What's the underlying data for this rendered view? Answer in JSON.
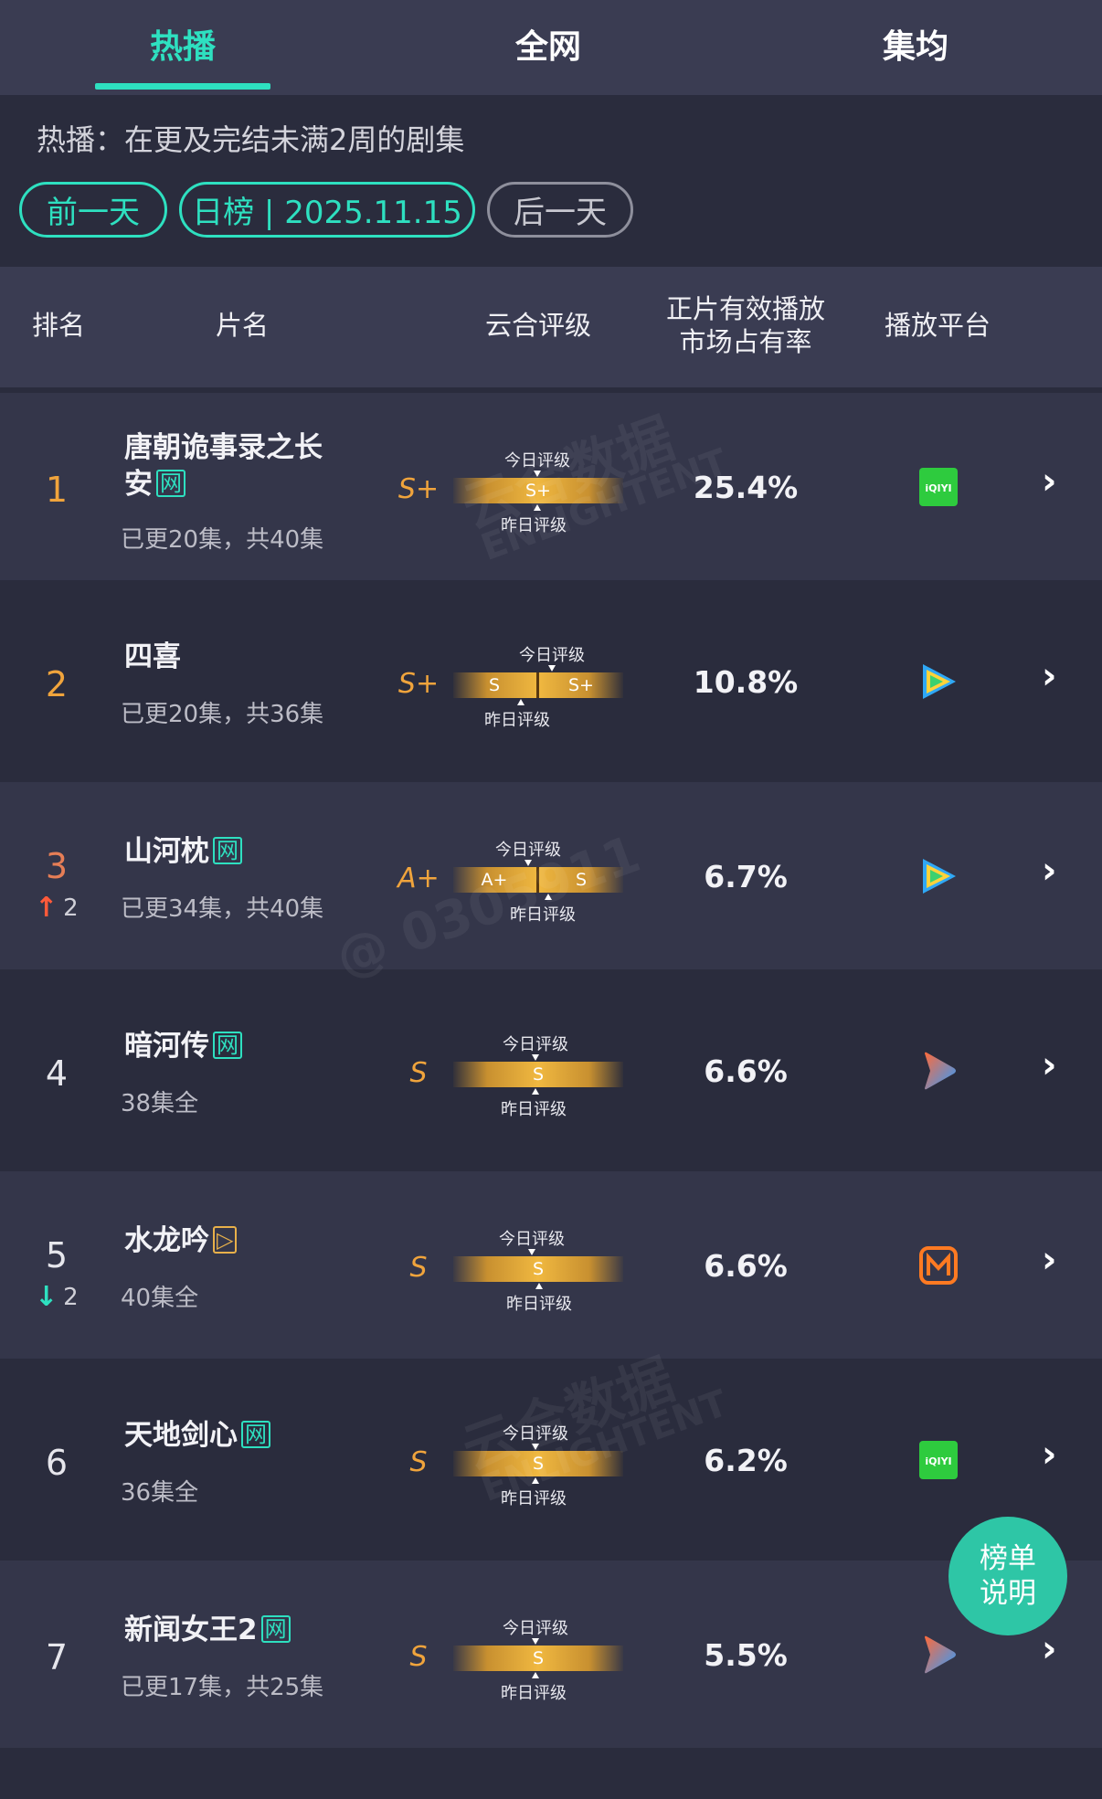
{
  "tabs": [
    {
      "label": "热播",
      "active": true
    },
    {
      "label": "全网",
      "active": false
    },
    {
      "label": "集均",
      "active": false
    }
  ],
  "subtitle": "热播：在更及完结未满2周的剧集",
  "date_nav": {
    "prev": "前一天",
    "current": "日榜 | 2025.11.15",
    "next": "后一天"
  },
  "columns": {
    "rank": "排名",
    "name": "片名",
    "grade": "云合评级",
    "share_line1": "正片有效播放",
    "share_line2": "市场占有率",
    "platform": "播放平台"
  },
  "grade_bar_labels": {
    "today": "今日评级",
    "yesterday": "昨日评级"
  },
  "rows": [
    {
      "rank": "1",
      "title": "唐朝诡事录之长安",
      "badge": "网",
      "episodes": "已更20集，共40集",
      "grade": "S+",
      "bar_left": "S+",
      "bar_right": "",
      "share": "25.4%",
      "platform": "iqiyi",
      "change": ""
    },
    {
      "rank": "2",
      "title": "四喜",
      "badge": "",
      "episodes": "已更20集，共36集",
      "grade": "S+",
      "bar_left": "S",
      "bar_right": "S+",
      "share": "10.8%",
      "platform": "tencent-video",
      "change": ""
    },
    {
      "rank": "3",
      "title": "山河枕",
      "badge": "网",
      "episodes": "已更34集，共40集",
      "grade": "A+",
      "bar_left": "A+",
      "bar_right": "S",
      "share": "6.7%",
      "platform": "tencent-video",
      "change": "2",
      "direction": "up"
    },
    {
      "rank": "4",
      "title": "暗河传",
      "badge": "网",
      "episodes": "38集全",
      "grade": "S",
      "bar_left": "S",
      "bar_right": "",
      "share": "6.6%",
      "platform": "youku",
      "change": ""
    },
    {
      "rank": "5",
      "title": "水龙吟",
      "badge": "▷",
      "episodes": "40集全",
      "grade": "S",
      "bar_left": "S",
      "bar_right": "",
      "share": "6.6%",
      "platform": "mango-tv",
      "change": "2",
      "direction": "down"
    },
    {
      "rank": "6",
      "title": "天地剑心",
      "badge": "网",
      "episodes": "36集全",
      "grade": "S",
      "bar_left": "S",
      "bar_right": "",
      "share": "6.2%",
      "platform": "iqiyi",
      "change": ""
    },
    {
      "rank": "7",
      "title": "新闻女王2",
      "badge": "网",
      "episodes": "已更17集，共25集",
      "grade": "S",
      "bar_left": "S",
      "bar_right": "",
      "share": "5.5%",
      "platform": "youku",
      "change": ""
    }
  ],
  "help_button": {
    "line1": "榜单",
    "line2": "说明"
  },
  "watermarks": [
    "云合数据",
    "ENLIGHTENT",
    "@ 0305911",
    "云合数据",
    "ENLIGHTENT"
  ],
  "colors": {
    "accent": "#2ee0c0",
    "grade": "#f0a43c",
    "bg": "#2a2c3d",
    "row_alt": "#34364a"
  }
}
